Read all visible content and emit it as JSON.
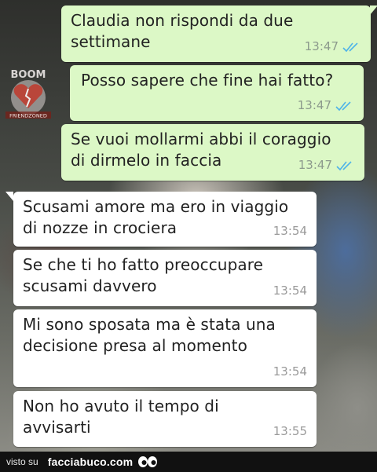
{
  "watermark": {
    "logo_text": "BOOM",
    "logo_sub": "FRIENDZONED"
  },
  "messages": [
    {
      "direction": "out",
      "text_lines": [
        "Claudia non rispondi da due",
        "settimane"
      ],
      "time": "13:47",
      "status": "read-double-tick"
    },
    {
      "direction": "out",
      "text_lines": [
        "Posso sapere che fine hai fatto?"
      ],
      "time": "13:47",
      "status": "read-double-tick"
    },
    {
      "direction": "out",
      "text_lines": [
        "Se vuoi mollarmi abbi il coraggio",
        "di dirmelo in faccia"
      ],
      "time": "13:47",
      "status": "read-double-tick"
    },
    {
      "direction": "in",
      "text_lines": [
        "Scusami amore ma ero in viaggio",
        "di nozze in crociera"
      ],
      "time": "13:54"
    },
    {
      "direction": "in",
      "text_lines": [
        "Se che ti ho fatto preoccupare",
        "scusami davvero"
      ],
      "time": "13:54"
    },
    {
      "direction": "in",
      "text_lines": [
        "Mi sono sposata ma è stata una",
        "decisione presa al momento"
      ],
      "time": "13:54"
    },
    {
      "direction": "in",
      "text_lines": [
        "Non ho avuto il tempo di",
        "avvisarti"
      ],
      "time": "13:55"
    }
  ],
  "footer": {
    "visto_label": "visto su",
    "site_label": "facciabuco.com",
    "eyes_icon": "eyes-icon"
  },
  "colors": {
    "outgoing_bubble": "#dcf8c6",
    "incoming_bubble": "#ffffff",
    "read_ticks": "#4fb3e8",
    "footer_bg": "#111111"
  }
}
